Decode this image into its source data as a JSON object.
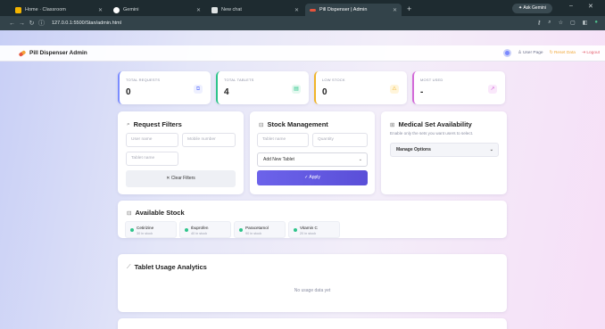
{
  "browser": {
    "tabs": [
      {
        "title": "Home · Classroom",
        "color": "#f4b400",
        "active": false
      },
      {
        "title": "Gemini",
        "color": "#ffffff",
        "active": false
      },
      {
        "title": "New chat",
        "color": "#ffffff",
        "active": false
      },
      {
        "title": "Pill Dispenser | Admin",
        "color": "#e5533c",
        "active": true
      }
    ],
    "new_tab": "+",
    "ask_gemini": "Ask Gemini",
    "minimize": "–",
    "close": "✕",
    "url": "127.0.0.1:5500/Stan/admin.html"
  },
  "header": {
    "brand": "Pill Dispenser Admin",
    "user_page": "User Page",
    "accent_btn": "Reset Data",
    "logout": "Logout"
  },
  "stats": [
    {
      "label": "TOTAL REQUESTS",
      "value": "0",
      "icon": "⧉",
      "color": "#7b8cff",
      "bg": "#eef0ff"
    },
    {
      "label": "TOTAL TABLETS",
      "value": "4",
      "icon": "▤",
      "color": "#2ec48b",
      "bg": "#e4f8ef"
    },
    {
      "label": "LOW STOCK",
      "value": "0",
      "icon": "⚠",
      "color": "#f0b429",
      "bg": "#fff5db"
    },
    {
      "label": "MOST USED",
      "value": "-",
      "icon": "↗",
      "color": "#d36ad8",
      "bg": "#fae8fb"
    }
  ],
  "request_filters": {
    "title": "Request Filters",
    "user_name_placeholder": "User name",
    "mobile_placeholder": "Mobile number",
    "tablet_placeholder": "Tablet name",
    "clear_label": "✕  Clear Filters"
  },
  "stock_management": {
    "title": "Stock Management",
    "tablet_placeholder": "Tablet name",
    "quantity_placeholder": "Quantity",
    "select_value": "Add New Tablet",
    "apply_label": "✓  Apply"
  },
  "medical_sets": {
    "title": "Medical Set Availability",
    "description": "Enable only the sets you want users to select.",
    "manage_label": "Manage Options"
  },
  "available_stock": {
    "title": "Available Stock",
    "items": [
      {
        "name": "Cetirizine",
        "qty": "30 in stock"
      },
      {
        "name": "Ibuprofen",
        "qty": "40 in stock"
      },
      {
        "name": "Paracetamol",
        "qty": "90 in stock"
      },
      {
        "name": "Vitamin C",
        "qty": "20 in stock"
      }
    ]
  },
  "analytics": {
    "title": "Tablet Usage Analytics",
    "empty": "No usage data yet"
  }
}
